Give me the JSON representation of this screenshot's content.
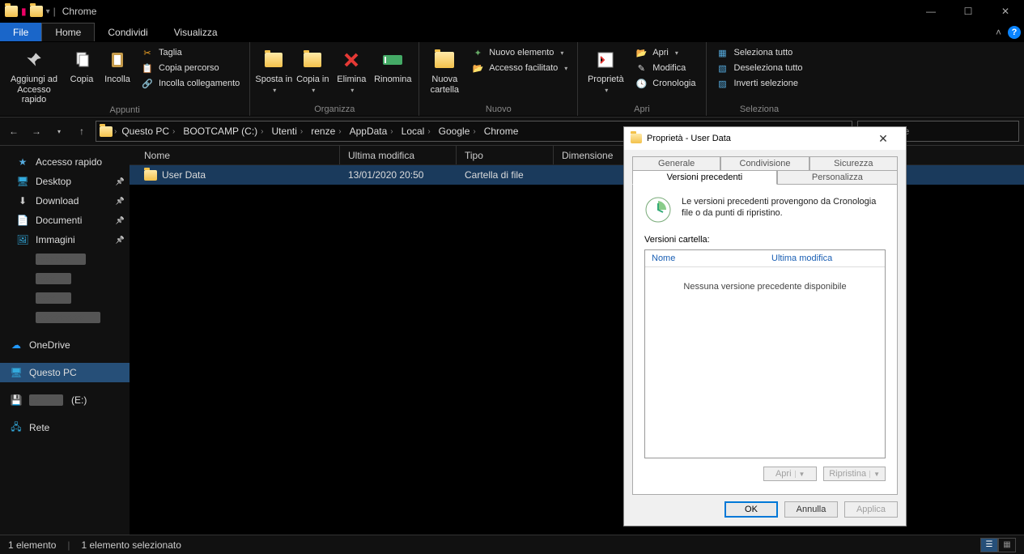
{
  "window": {
    "title": "Chrome"
  },
  "sys": {
    "min": "—",
    "max": "☐",
    "close": "✕"
  },
  "menu": {
    "file": "File",
    "home": "Home",
    "share": "Condividi",
    "view": "Visualizza"
  },
  "ribbon": {
    "clipboard": {
      "label": "Appunti",
      "pin": "Aggiungi ad Accesso rapido",
      "copy": "Copia",
      "paste": "Incolla",
      "cut": "Taglia",
      "copypath": "Copia percorso",
      "pasteshortcut": "Incolla collegamento"
    },
    "organize": {
      "label": "Organizza",
      "moveto": "Sposta in",
      "copyto": "Copia in",
      "delete": "Elimina",
      "rename": "Rinomina"
    },
    "new": {
      "label": "Nuovo",
      "newfolder": "Nuova cartella",
      "newitem": "Nuovo elemento",
      "easyaccess": "Accesso facilitato"
    },
    "open": {
      "label": "Apri",
      "properties": "Proprietà",
      "open": "Apri",
      "edit": "Modifica",
      "history": "Cronologia"
    },
    "select": {
      "label": "Seleziona",
      "all": "Seleziona tutto",
      "none": "Deseleziona tutto",
      "invert": "Inverti selezione"
    }
  },
  "breadcrumbs": [
    "Questo PC",
    "BOOTCAMP (C:)",
    "Utenti",
    "renze",
    "AppData",
    "Local",
    "Google",
    "Chrome"
  ],
  "search_placeholder": "in Chrome",
  "columns": {
    "name": "Nome",
    "modified": "Ultima modifica",
    "type": "Tipo",
    "size": "Dimensione"
  },
  "files": [
    {
      "name": "User Data",
      "modified": "13/01/2020 20:50",
      "type": "Cartella di file",
      "size": ""
    }
  ],
  "sidebar": {
    "quick": "Accesso rapido",
    "desktop": "Desktop",
    "download": "Download",
    "documents": "Documenti",
    "images": "Immagini",
    "onedrive": "OneDrive",
    "thispc": "Questo PC",
    "drive": "(E:)",
    "network": "Rete"
  },
  "status": {
    "count": "1 elemento",
    "selected": "1 elemento selezionato"
  },
  "dialog": {
    "title": "Proprietà - User Data",
    "tabs": {
      "general": "Generale",
      "sharing": "Condivisione",
      "security": "Sicurezza",
      "prev": "Versioni precedenti",
      "custom": "Personalizza"
    },
    "info": "Le versioni precedenti provengono da Cronologia file o da punti di ripristino.",
    "section": "Versioni cartella:",
    "thead": {
      "name": "Nome",
      "modified": "Ultima modifica"
    },
    "empty": "Nessuna versione precedente disponibile",
    "open": "Apri",
    "restore": "Ripristina",
    "ok": "OK",
    "cancel": "Annulla",
    "apply": "Applica"
  }
}
